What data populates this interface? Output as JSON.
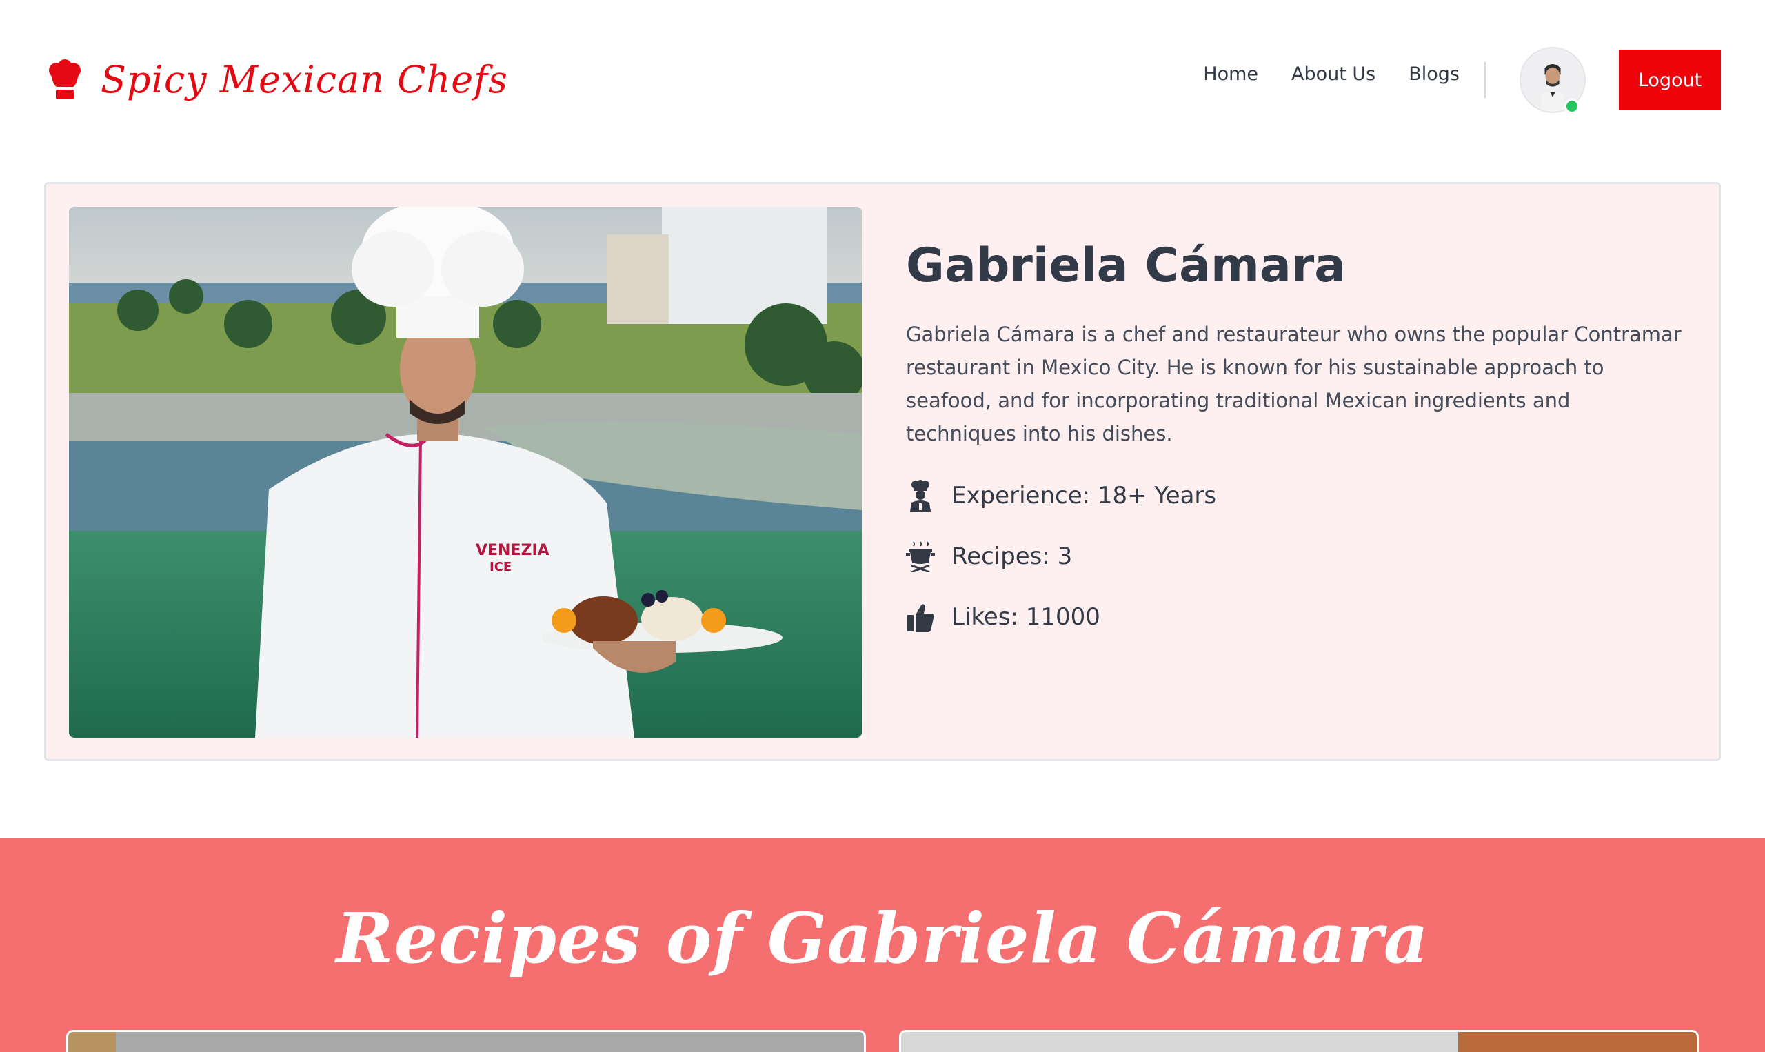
{
  "navbar": {
    "brand_name": "Spicy Mexican Chefs",
    "brand_icon": "chef-hat-icon",
    "links": [
      "Home",
      "About Us",
      "Blogs"
    ],
    "logout_label": "Logout",
    "avatar_status": "online"
  },
  "chef": {
    "name": "Gabriela Cámara",
    "bio": "Gabriela Cámara is a chef and restaurateur who owns the popular Contramar restaurant in Mexico City. He is known for his sustainable approach to seafood, and for incorporating traditional Mexican ingredients and techniques into his dishes.",
    "stats": {
      "experience": "Experience: 18+ Years",
      "recipes": "Recipes: 3",
      "likes": "Likes: 11000"
    }
  },
  "recipes_section": {
    "title": "Recipes of Gabriela Cámara"
  },
  "colors": {
    "brand_red": "#e50914",
    "logout_red": "#f0040c",
    "card_background": "#fef0f0",
    "recipes_background": "#f56f71",
    "online_green": "#22c55e"
  }
}
